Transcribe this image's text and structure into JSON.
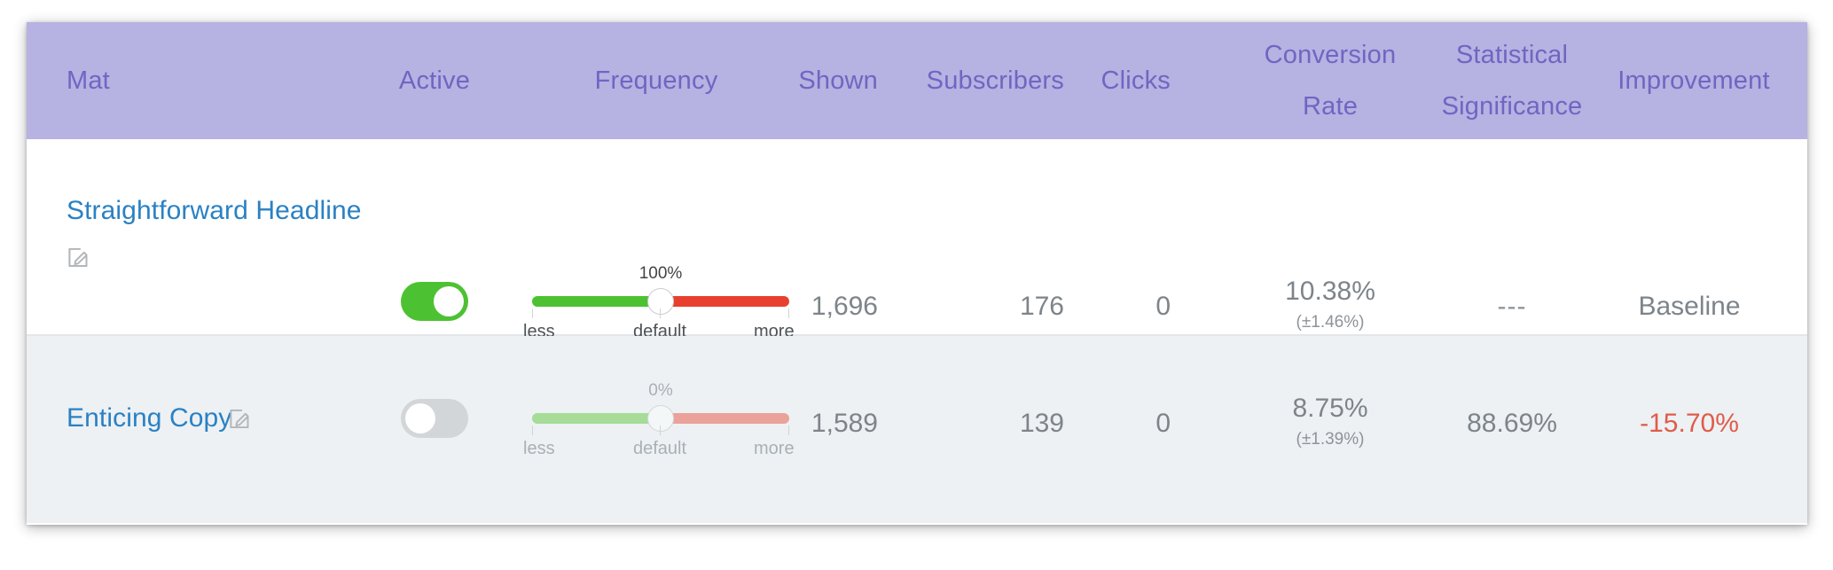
{
  "table": {
    "columns": [
      {
        "key": "mat",
        "label": "Mat",
        "align": "left"
      },
      {
        "key": "active",
        "label": "Active",
        "align": "center"
      },
      {
        "key": "frequency",
        "label": "Frequency",
        "align": "center"
      },
      {
        "key": "shown",
        "label": "Shown",
        "align": "right"
      },
      {
        "key": "subscribers",
        "label": "Subscribers",
        "align": "right"
      },
      {
        "key": "clicks",
        "label": "Clicks",
        "align": "right"
      },
      {
        "key": "conversion",
        "label_line1": "Conversion",
        "label_line2": "Rate",
        "align": "center"
      },
      {
        "key": "significance",
        "label_line1": "Statistical",
        "label_line2": "Significance",
        "align": "center"
      },
      {
        "key": "improvement",
        "label": "Improvement",
        "align": "center"
      }
    ],
    "rows": [
      {
        "name": "Straightforward Headline",
        "edit_icon": "edit-pencil-square-icon",
        "active": true,
        "active_state_label": "on",
        "frequency": {
          "value_label": "100%",
          "value_percent": 100,
          "tick_less": "less",
          "tick_default": "default",
          "tick_more": "more"
        },
        "shown": "1,696",
        "subscribers": "176",
        "clicks": "0",
        "conversion_rate": "10.38%",
        "conversion_margin": "(±1.46%)",
        "statistical_significance": "---",
        "improvement": "Baseline",
        "improvement_kind": "baseline"
      },
      {
        "name": "Enticing Copy",
        "edit_icon": "edit-pencil-square-icon",
        "active": false,
        "active_state_label": "off",
        "frequency": {
          "value_label": "0%",
          "value_percent": 0,
          "tick_less": "less",
          "tick_default": "default",
          "tick_more": "more"
        },
        "shown": "1,589",
        "subscribers": "139",
        "clicks": "0",
        "conversion_rate": "8.75%",
        "conversion_margin": "(±1.39%)",
        "statistical_significance": "88.69%",
        "improvement": "-15.70%",
        "improvement_kind": "negative"
      }
    ]
  },
  "colors": {
    "header_background": "#b6b2e2",
    "header_text": "#6f66c2",
    "link": "#2a81c4",
    "toggle_on": "#4cc232",
    "toggle_off": "#d2d6d9",
    "slider_left_active": "#4cc232",
    "slider_right_active": "#e7402e",
    "slider_left_muted": "#a6dc97",
    "slider_right_muted": "#eaa29b",
    "row_alt_background": "#edf1f3",
    "negative": "#e05c4b",
    "muted_text": "#7d848a"
  }
}
